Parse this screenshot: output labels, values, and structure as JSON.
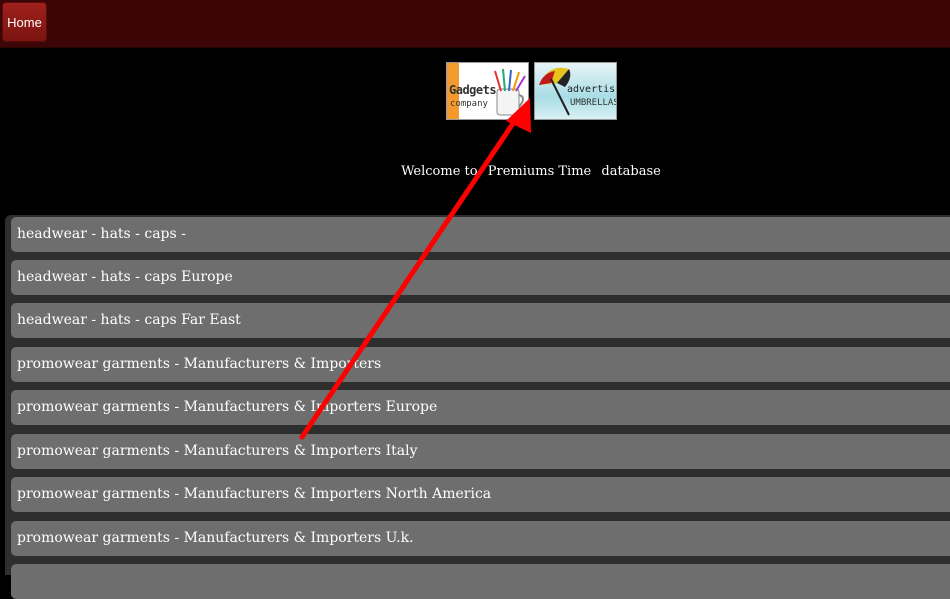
{
  "topbar": {
    "home_label": "Home"
  },
  "logos": {
    "gadgets": {
      "line1": "Gadgets",
      "line2": "company"
    },
    "umbrellas": {
      "line1": "advertising",
      "line2": "UMBRELLAS"
    }
  },
  "welcome": {
    "part1": "Welcome to",
    "part2": "Premiums Time",
    "part3": "database"
  },
  "list": {
    "items": [
      {
        "label": "headwear - hats - caps -"
      },
      {
        "label": "headwear - hats - caps Europe"
      },
      {
        "label": "headwear - hats - caps Far East"
      },
      {
        "label": "promowear garments - Manufacturers & Importers"
      },
      {
        "label": "promowear garments - Manufacturers & Importers Europe"
      },
      {
        "label": "promowear garments - Manufacturers & Importers Italy"
      },
      {
        "label": "promowear garments - Manufacturers & Importers North America"
      },
      {
        "label": "promowear garments - Manufacturers & Importers U.k."
      }
    ]
  },
  "colors": {
    "topbar": "#3d0606",
    "home_button": "#9a1c18",
    "list_item": "#6e6e6e",
    "annotation_arrow": "#ff0000"
  }
}
